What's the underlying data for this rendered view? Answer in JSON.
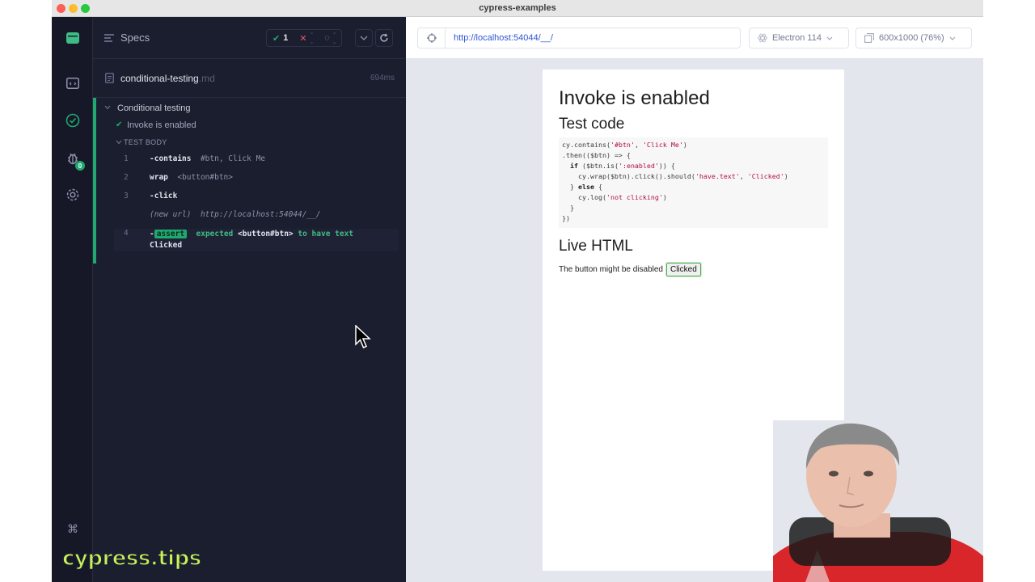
{
  "window": {
    "title": "cypress-examples"
  },
  "reporter": {
    "specs_label": "Specs",
    "stats": {
      "passed": "1",
      "failed": "--",
      "pending": "--"
    },
    "spec": {
      "name": "conditional-testing",
      "ext": ".md",
      "duration": "694ms"
    },
    "suite_title": "Conditional testing",
    "test_title": "Invoke is enabled",
    "test_body_label": "TEST BODY",
    "commands": [
      {
        "num": "1",
        "name": "-contains",
        "message": "#btn, Click Me"
      },
      {
        "num": "2",
        "name": "wrap",
        "message": "<button#btn>"
      },
      {
        "num": "3",
        "name": "-click",
        "message": ""
      },
      {
        "num": "",
        "name": "(new url)",
        "message": "http://localhost:54044/__/"
      },
      {
        "num": "4",
        "name": "-",
        "tag": "assert",
        "message_parts": [
          "expected",
          "<button#btn>",
          "to have text",
          "Clicked"
        ]
      }
    ]
  },
  "aut": {
    "url": "http://localhost:54044/__/",
    "browser": "Electron 114",
    "viewport": "600x1000 (76%)"
  },
  "page": {
    "h1": "Invoke is enabled",
    "h2_code": "Test code",
    "code_lines": [
      "cy.contains('#btn', 'Click Me')",
      ".then(($btn) => {",
      "  if ($btn.is(':enabled')) {",
      "    cy.wrap($btn).click().should('have.text', 'Clicked')",
      "  } else {",
      "    cy.log('not clicking')",
      "  }",
      "})"
    ],
    "h2_live": "Live HTML",
    "live_text": "The button might be disabled",
    "button_label": "Clicked"
  },
  "watermark": "cypress.tips",
  "colors": {
    "pass_green": "#1fa971",
    "link_blue": "#2f55d4",
    "panel_bg": "#1b1e2e"
  },
  "icons": [
    "cypress-logo-icon",
    "specs-list-icon",
    "runs-icon",
    "debug-icon",
    "settings-icon",
    "keyboard-shortcuts-icon",
    "refresh-icon",
    "chevron-down-icon",
    "crosshair-icon",
    "electron-icon",
    "viewport-icon",
    "mouse-cursor-icon"
  ],
  "badges": {
    "debug_count": "0"
  }
}
